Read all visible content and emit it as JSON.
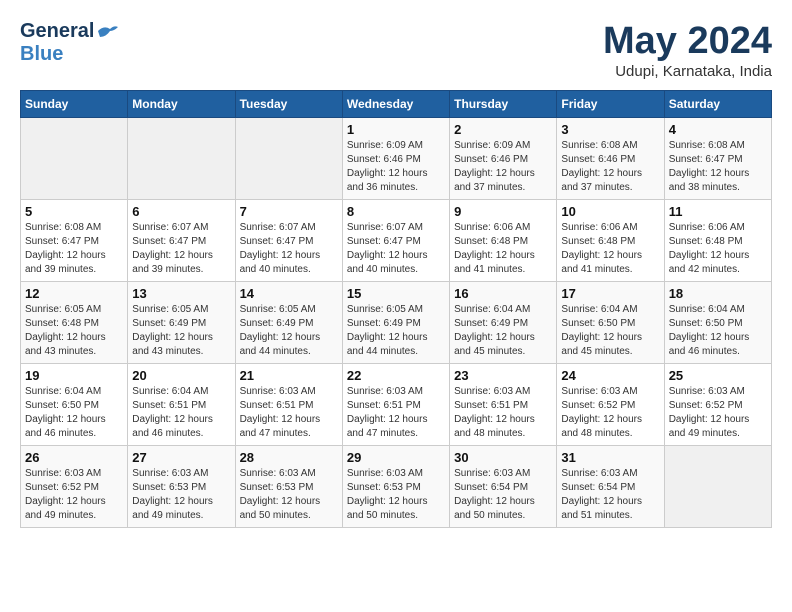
{
  "header": {
    "logo_general": "General",
    "logo_blue": "Blue",
    "month_year": "May 2024",
    "location": "Udupi, Karnataka, India"
  },
  "weekdays": [
    "Sunday",
    "Monday",
    "Tuesday",
    "Wednesday",
    "Thursday",
    "Friday",
    "Saturday"
  ],
  "weeks": [
    [
      {
        "day": "",
        "info": ""
      },
      {
        "day": "",
        "info": ""
      },
      {
        "day": "",
        "info": ""
      },
      {
        "day": "1",
        "info": "Sunrise: 6:09 AM\nSunset: 6:46 PM\nDaylight: 12 hours\nand 36 minutes."
      },
      {
        "day": "2",
        "info": "Sunrise: 6:09 AM\nSunset: 6:46 PM\nDaylight: 12 hours\nand 37 minutes."
      },
      {
        "day": "3",
        "info": "Sunrise: 6:08 AM\nSunset: 6:46 PM\nDaylight: 12 hours\nand 37 minutes."
      },
      {
        "day": "4",
        "info": "Sunrise: 6:08 AM\nSunset: 6:47 PM\nDaylight: 12 hours\nand 38 minutes."
      }
    ],
    [
      {
        "day": "5",
        "info": "Sunrise: 6:08 AM\nSunset: 6:47 PM\nDaylight: 12 hours\nand 39 minutes."
      },
      {
        "day": "6",
        "info": "Sunrise: 6:07 AM\nSunset: 6:47 PM\nDaylight: 12 hours\nand 39 minutes."
      },
      {
        "day": "7",
        "info": "Sunrise: 6:07 AM\nSunset: 6:47 PM\nDaylight: 12 hours\nand 40 minutes."
      },
      {
        "day": "8",
        "info": "Sunrise: 6:07 AM\nSunset: 6:47 PM\nDaylight: 12 hours\nand 40 minutes."
      },
      {
        "day": "9",
        "info": "Sunrise: 6:06 AM\nSunset: 6:48 PM\nDaylight: 12 hours\nand 41 minutes."
      },
      {
        "day": "10",
        "info": "Sunrise: 6:06 AM\nSunset: 6:48 PM\nDaylight: 12 hours\nand 41 minutes."
      },
      {
        "day": "11",
        "info": "Sunrise: 6:06 AM\nSunset: 6:48 PM\nDaylight: 12 hours\nand 42 minutes."
      }
    ],
    [
      {
        "day": "12",
        "info": "Sunrise: 6:05 AM\nSunset: 6:48 PM\nDaylight: 12 hours\nand 43 minutes."
      },
      {
        "day": "13",
        "info": "Sunrise: 6:05 AM\nSunset: 6:49 PM\nDaylight: 12 hours\nand 43 minutes."
      },
      {
        "day": "14",
        "info": "Sunrise: 6:05 AM\nSunset: 6:49 PM\nDaylight: 12 hours\nand 44 minutes."
      },
      {
        "day": "15",
        "info": "Sunrise: 6:05 AM\nSunset: 6:49 PM\nDaylight: 12 hours\nand 44 minutes."
      },
      {
        "day": "16",
        "info": "Sunrise: 6:04 AM\nSunset: 6:49 PM\nDaylight: 12 hours\nand 45 minutes."
      },
      {
        "day": "17",
        "info": "Sunrise: 6:04 AM\nSunset: 6:50 PM\nDaylight: 12 hours\nand 45 minutes."
      },
      {
        "day": "18",
        "info": "Sunrise: 6:04 AM\nSunset: 6:50 PM\nDaylight: 12 hours\nand 46 minutes."
      }
    ],
    [
      {
        "day": "19",
        "info": "Sunrise: 6:04 AM\nSunset: 6:50 PM\nDaylight: 12 hours\nand 46 minutes."
      },
      {
        "day": "20",
        "info": "Sunrise: 6:04 AM\nSunset: 6:51 PM\nDaylight: 12 hours\nand 46 minutes."
      },
      {
        "day": "21",
        "info": "Sunrise: 6:03 AM\nSunset: 6:51 PM\nDaylight: 12 hours\nand 47 minutes."
      },
      {
        "day": "22",
        "info": "Sunrise: 6:03 AM\nSunset: 6:51 PM\nDaylight: 12 hours\nand 47 minutes."
      },
      {
        "day": "23",
        "info": "Sunrise: 6:03 AM\nSunset: 6:51 PM\nDaylight: 12 hours\nand 48 minutes."
      },
      {
        "day": "24",
        "info": "Sunrise: 6:03 AM\nSunset: 6:52 PM\nDaylight: 12 hours\nand 48 minutes."
      },
      {
        "day": "25",
        "info": "Sunrise: 6:03 AM\nSunset: 6:52 PM\nDaylight: 12 hours\nand 49 minutes."
      }
    ],
    [
      {
        "day": "26",
        "info": "Sunrise: 6:03 AM\nSunset: 6:52 PM\nDaylight: 12 hours\nand 49 minutes."
      },
      {
        "day": "27",
        "info": "Sunrise: 6:03 AM\nSunset: 6:53 PM\nDaylight: 12 hours\nand 49 minutes."
      },
      {
        "day": "28",
        "info": "Sunrise: 6:03 AM\nSunset: 6:53 PM\nDaylight: 12 hours\nand 50 minutes."
      },
      {
        "day": "29",
        "info": "Sunrise: 6:03 AM\nSunset: 6:53 PM\nDaylight: 12 hours\nand 50 minutes."
      },
      {
        "day": "30",
        "info": "Sunrise: 6:03 AM\nSunset: 6:54 PM\nDaylight: 12 hours\nand 50 minutes."
      },
      {
        "day": "31",
        "info": "Sunrise: 6:03 AM\nSunset: 6:54 PM\nDaylight: 12 hours\nand 51 minutes."
      },
      {
        "day": "",
        "info": ""
      }
    ]
  ]
}
